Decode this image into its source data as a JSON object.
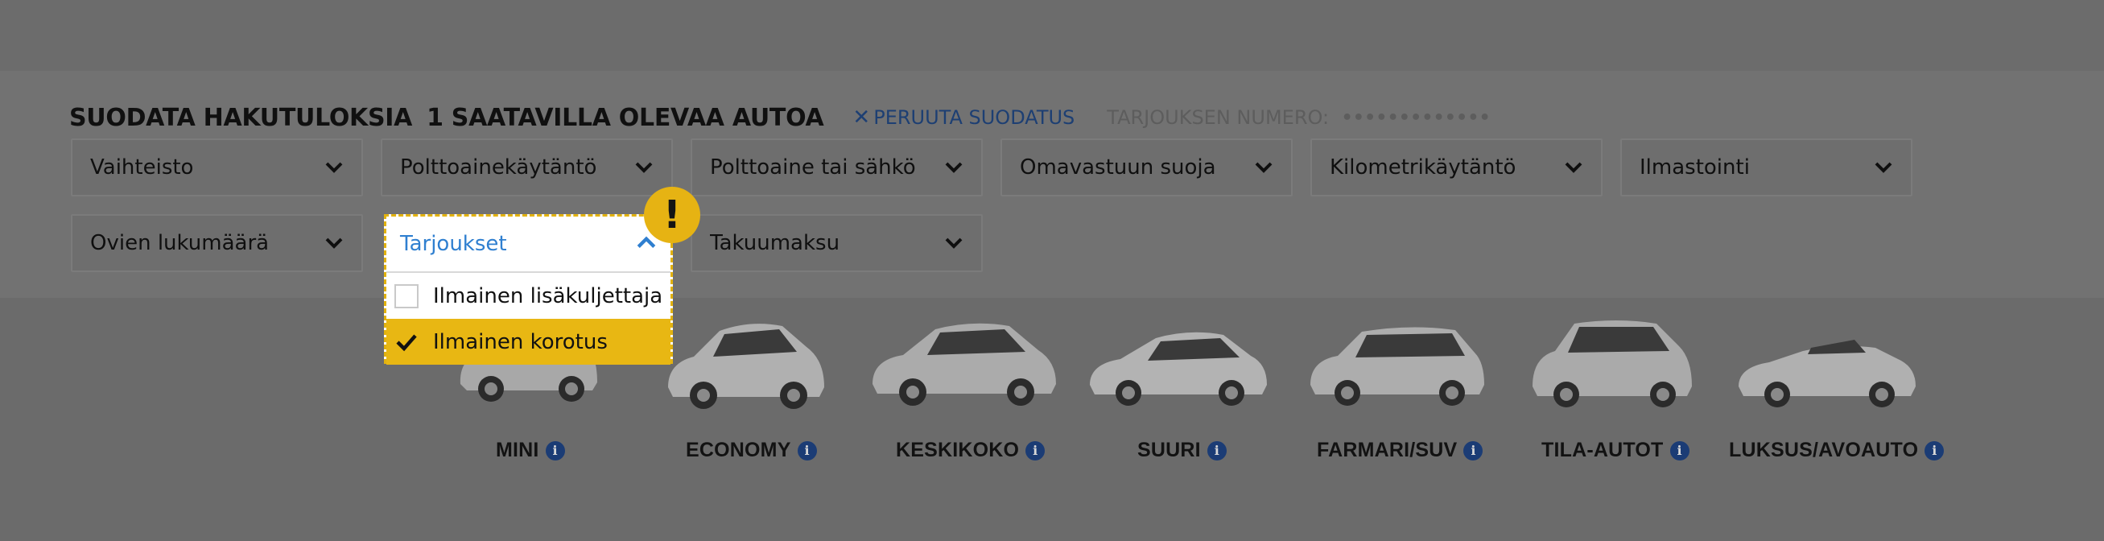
{
  "header": {
    "title": "SUODATA HAKUTULOKSIA",
    "count": "1 SAATAVILLA OLEVAA AUTOA",
    "cancel_label": "PERUUTA SUODATUS",
    "offer_label": "TARJOUKSEN NUMERO:",
    "offer_value": "•••••••••••••"
  },
  "filters": {
    "transmission": "Vaihteisto",
    "fuel_policy": "Polttoainekäytäntö",
    "fuel_type": "Polttoaine tai sähkö",
    "excess_cover": "Omavastuun suoja",
    "mileage_policy": "Kilometrikäytäntö",
    "air_conditioning": "Ilmastointi",
    "doors": "Ovien lukumäärä",
    "deposit": "Takuumaksu"
  },
  "offers_dropdown": {
    "label": "Tarjoukset",
    "options": [
      {
        "label": "Ilmainen lisäkuljettaja",
        "checked": false
      },
      {
        "label": "Ilmainen korotus",
        "checked": true
      }
    ]
  },
  "alert_icon": "!",
  "categories": [
    "MINI",
    "ECONOMY",
    "KESKIKOKO",
    "SUURI",
    "FARMARI/SUV",
    "TILA-AUTOT",
    "LUKSUS/AVOAUTO"
  ],
  "info_glyph": "i",
  "colors": {
    "accent_yellow": "#e8b713",
    "link_blue": "#2f7fd0",
    "navy": "#1b3c75"
  }
}
